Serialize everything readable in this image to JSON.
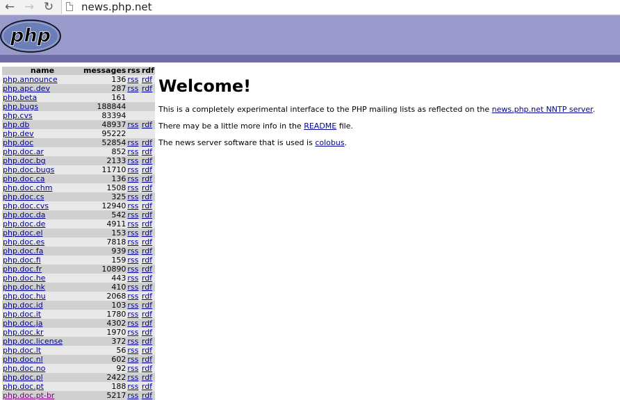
{
  "browser": {
    "url": "news.php.net",
    "back_icon": "arrow-left",
    "forward_icon": "arrow-right",
    "reload_icon": "reload",
    "page_icon": "document"
  },
  "header": {
    "logo_text": "php",
    "colors": {
      "band": "#9999cc",
      "bar": "#6e6ea8"
    }
  },
  "table": {
    "headers": {
      "name": "name",
      "messages": "messages",
      "rss": "rss",
      "rdf": "rdf"
    },
    "rows": [
      {
        "name": "php.announce",
        "messages": "136",
        "rss": "rss",
        "rdf": "rdf"
      },
      {
        "name": "php.apc.dev",
        "messages": "287",
        "rss": "rss",
        "rdf": "rdf"
      },
      {
        "name": "php.beta",
        "messages": "161",
        "rss": "",
        "rdf": ""
      },
      {
        "name": "php.bugs",
        "messages": "188844",
        "rss": "",
        "rdf": ""
      },
      {
        "name": "php.cvs",
        "messages": "83394",
        "rss": "",
        "rdf": ""
      },
      {
        "name": "php.db",
        "messages": "48937",
        "rss": "rss",
        "rdf": "rdf"
      },
      {
        "name": "php.dev",
        "messages": "95222",
        "rss": "",
        "rdf": ""
      },
      {
        "name": "php.doc",
        "messages": "52854",
        "rss": "rss",
        "rdf": "rdf"
      },
      {
        "name": "php.doc.ar",
        "messages": "852",
        "rss": "rss",
        "rdf": "rdf"
      },
      {
        "name": "php.doc.bg",
        "messages": "2133",
        "rss": "rss",
        "rdf": "rdf"
      },
      {
        "name": "php.doc.bugs",
        "messages": "11710",
        "rss": "rss",
        "rdf": "rdf"
      },
      {
        "name": "php.doc.ca",
        "messages": "136",
        "rss": "rss",
        "rdf": "rdf"
      },
      {
        "name": "php.doc.chm",
        "messages": "1508",
        "rss": "rss",
        "rdf": "rdf"
      },
      {
        "name": "php.doc.cs",
        "messages": "325",
        "rss": "rss",
        "rdf": "rdf"
      },
      {
        "name": "php.doc.cvs",
        "messages": "12940",
        "rss": "rss",
        "rdf": "rdf"
      },
      {
        "name": "php.doc.da",
        "messages": "542",
        "rss": "rss",
        "rdf": "rdf"
      },
      {
        "name": "php.doc.de",
        "messages": "4911",
        "rss": "rss",
        "rdf": "rdf"
      },
      {
        "name": "php.doc.el",
        "messages": "153",
        "rss": "rss",
        "rdf": "rdf"
      },
      {
        "name": "php.doc.es",
        "messages": "7818",
        "rss": "rss",
        "rdf": "rdf"
      },
      {
        "name": "php.doc.fa",
        "messages": "939",
        "rss": "rss",
        "rdf": "rdf"
      },
      {
        "name": "php.doc.fi",
        "messages": "159",
        "rss": "rss",
        "rdf": "rdf"
      },
      {
        "name": "php.doc.fr",
        "messages": "10890",
        "rss": "rss",
        "rdf": "rdf"
      },
      {
        "name": "php.doc.he",
        "messages": "443",
        "rss": "rss",
        "rdf": "rdf"
      },
      {
        "name": "php.doc.hk",
        "messages": "410",
        "rss": "rss",
        "rdf": "rdf"
      },
      {
        "name": "php.doc.hu",
        "messages": "2068",
        "rss": "rss",
        "rdf": "rdf"
      },
      {
        "name": "php.doc.id",
        "messages": "103",
        "rss": "rss",
        "rdf": "rdf"
      },
      {
        "name": "php.doc.it",
        "messages": "1780",
        "rss": "rss",
        "rdf": "rdf"
      },
      {
        "name": "php.doc.ja",
        "messages": "4302",
        "rss": "rss",
        "rdf": "rdf"
      },
      {
        "name": "php.doc.kr",
        "messages": "1970",
        "rss": "rss",
        "rdf": "rdf"
      },
      {
        "name": "php.doc.license",
        "messages": "372",
        "rss": "rss",
        "rdf": "rdf"
      },
      {
        "name": "php.doc.lt",
        "messages": "56",
        "rss": "rss",
        "rdf": "rdf"
      },
      {
        "name": "php.doc.nl",
        "messages": "602",
        "rss": "rss",
        "rdf": "rdf"
      },
      {
        "name": "php.doc.no",
        "messages": "92",
        "rss": "rss",
        "rdf": "rdf"
      },
      {
        "name": "php.doc.pl",
        "messages": "2422",
        "rss": "rss",
        "rdf": "rdf"
      },
      {
        "name": "php.doc.pt",
        "messages": "188",
        "rss": "rss",
        "rdf": "rdf"
      },
      {
        "name": "php.doc.pt-br",
        "messages": "5217",
        "rss": "rss",
        "rdf": "rdf",
        "visited": true
      }
    ]
  },
  "main": {
    "title": "Welcome!",
    "p1": {
      "before": "This is a completely experimental interface to the PHP mailing lists as reflected on the ",
      "link": "news.php.net NNTP server",
      "after": "."
    },
    "p2": {
      "before": "There may be a little more info in the ",
      "link": "README",
      "after": " file."
    },
    "p3": {
      "before": "The news server software that is used is ",
      "link": "colobus",
      "after": "."
    }
  }
}
